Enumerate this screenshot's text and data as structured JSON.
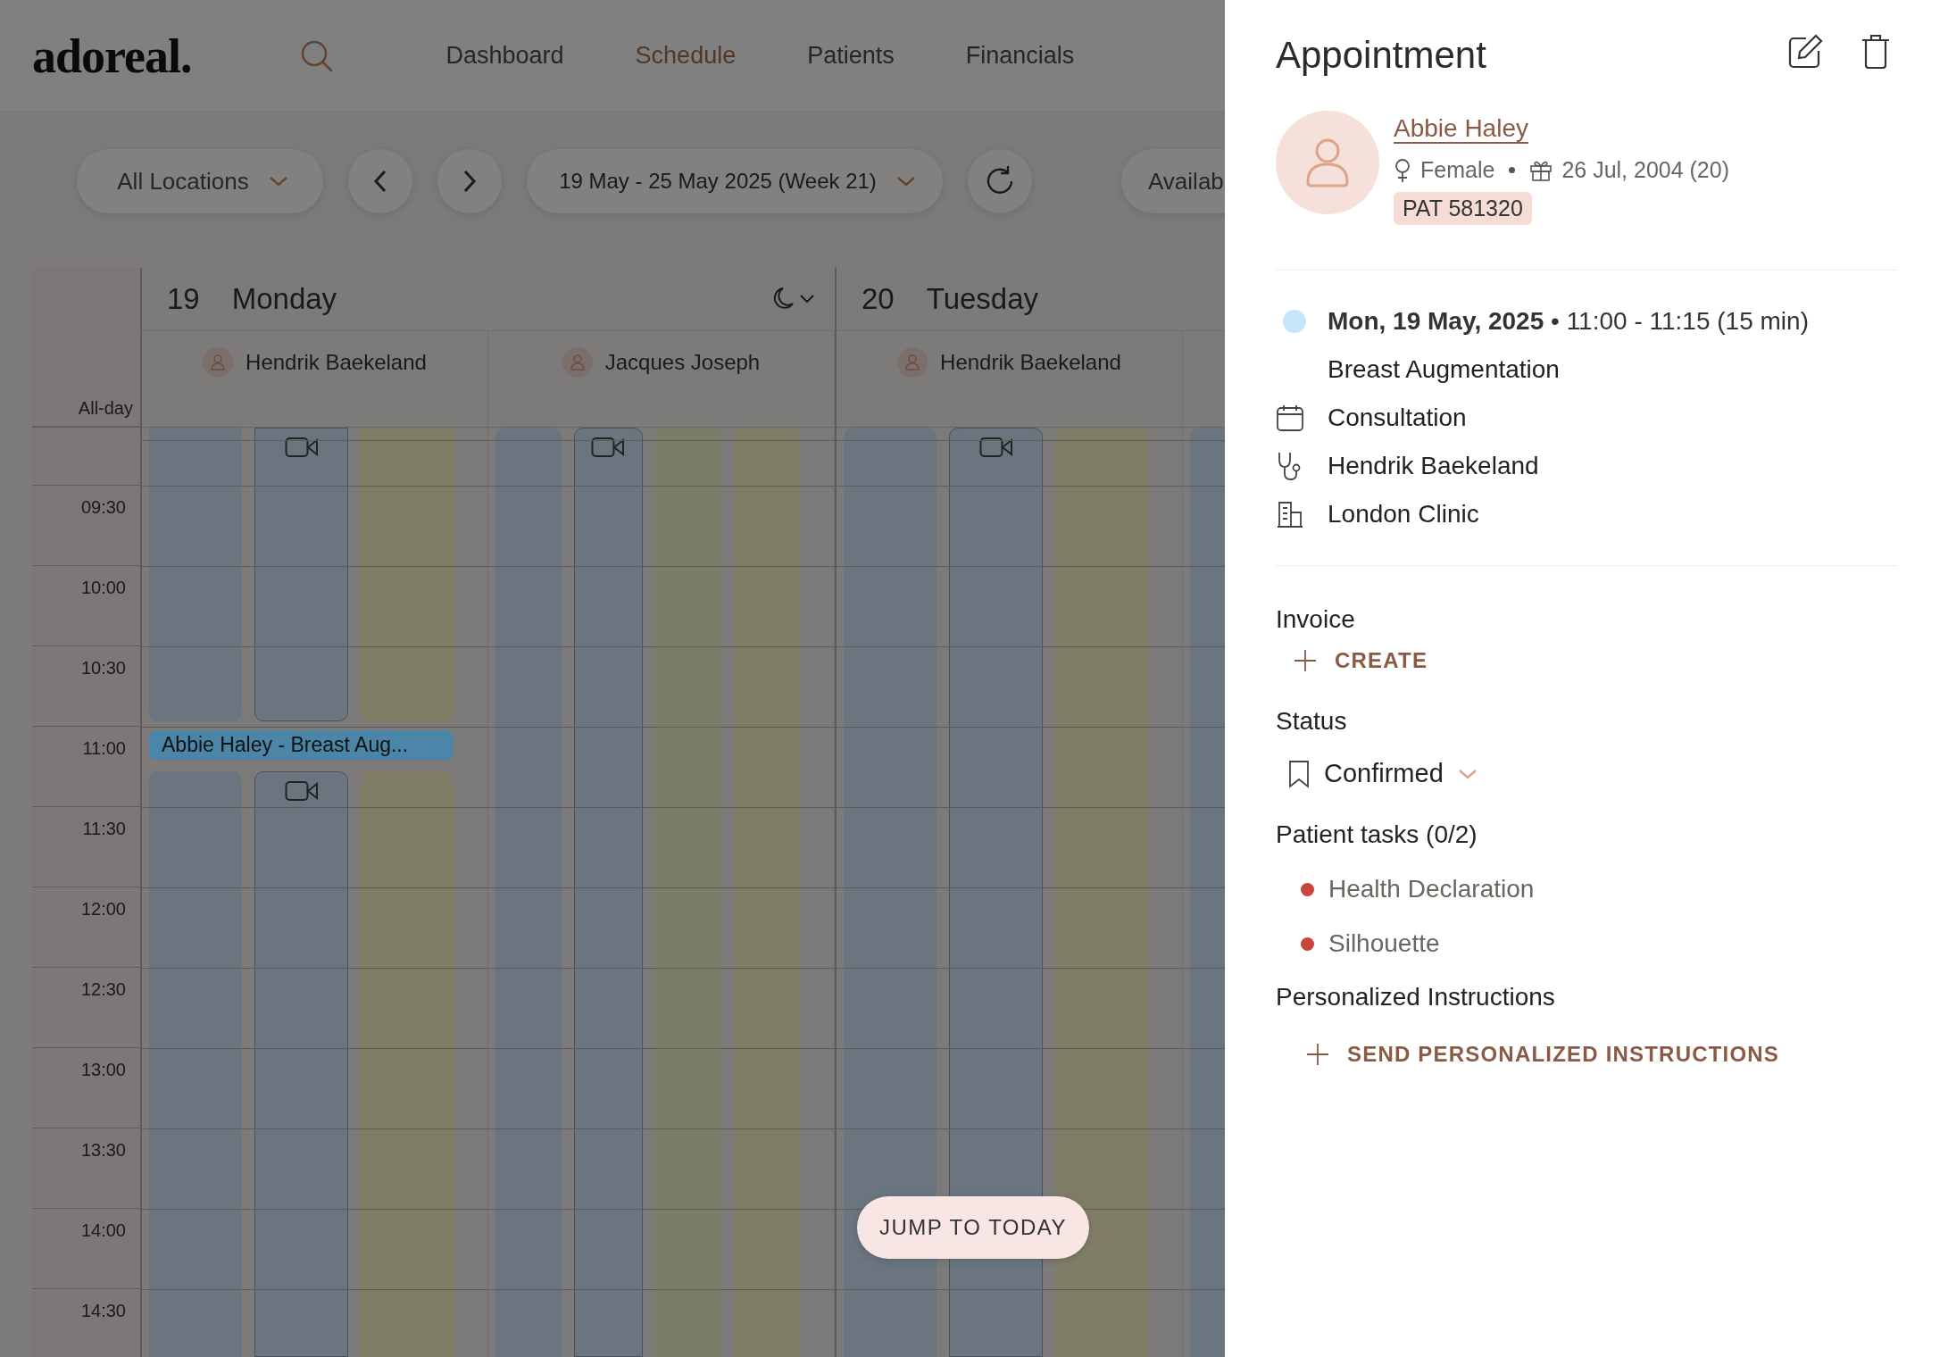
{
  "nav": {
    "logo": "adoreal.",
    "items": [
      {
        "label": "Dashboard",
        "selected": false
      },
      {
        "label": "Schedule",
        "selected": true
      },
      {
        "label": "Patients",
        "selected": false
      },
      {
        "label": "Financials",
        "selected": false
      }
    ]
  },
  "toolbar": {
    "location": "All Locations",
    "week": "19 May - 25 May 2025 (Week 21)",
    "availability": "Availab"
  },
  "calendar": {
    "all_day": "All-day",
    "times": [
      "09:30",
      "10:00",
      "10:30",
      "11:00",
      "11:30",
      "12:00",
      "12:30",
      "13:00",
      "13:30",
      "14:00",
      "14:30"
    ],
    "days": [
      {
        "date": "19",
        "weekday": "Monday",
        "show_menu": true,
        "doctors": [
          {
            "name": "Hendrik Baekeland",
            "lanes": [
              {
                "color": "#6a7580",
                "video": false
              },
              {
                "color": "#6a7580",
                "video": true
              },
              {
                "color": "#7f7d66",
                "video": false
              }
            ],
            "events": [
              {
                "title": "Abbie Haley - Breast Aug..."
              }
            ]
          },
          {
            "name": "Jacques Joseph",
            "lanes": [
              {
                "color": "#6a7580",
                "video": false
              },
              {
                "color": "#6a7580",
                "video": true
              },
              {
                "color": "#777d66",
                "video": false
              },
              {
                "color": "#7f7d66",
                "video": false
              }
            ]
          }
        ]
      },
      {
        "date": "20",
        "weekday": "Tuesday",
        "show_menu": false,
        "doctors": [
          {
            "name": "Hendrik Baekeland",
            "lanes": [
              {
                "color": "#6a7580",
                "video": false
              },
              {
                "color": "#6a7580",
                "video": true
              },
              {
                "color": "#7f7d66",
                "video": false
              }
            ]
          },
          {
            "lanes": [
              {
                "color": "#6a7580",
                "video": false
              }
            ]
          }
        ]
      }
    ]
  },
  "jump_button": "JUMP TO TODAY",
  "panel": {
    "title": "Appointment",
    "patient": {
      "name": "Abbie Haley",
      "gender": "Female",
      "birth": "26 Jul, 2004 (20)",
      "id": "PAT 581320"
    },
    "appointment": {
      "when": "**Mon, 19 May, 2025** • 11:00 - 11:15 (15 min)",
      "treatment": "Breast Augmentation",
      "type": "Consultation",
      "practitioner": "Hendrik Baekeland",
      "location": "London Clinic"
    },
    "invoice": {
      "label": "Invoice",
      "action": "CREATE"
    },
    "status": {
      "label": "Status",
      "value": "Confirmed"
    },
    "tasks": {
      "label": "Patient tasks (0/2)",
      "items": [
        {
          "label": "Health Declaration",
          "done": false
        },
        {
          "label": "Silhouette",
          "done": false
        }
      ]
    },
    "instructions": {
      "label": "Personalized Instructions",
      "action": "SEND PERSONALIZED INSTRUCTIONS"
    }
  }
}
